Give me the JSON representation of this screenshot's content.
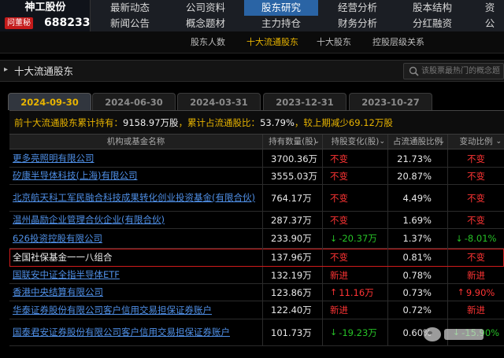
{
  "stock": {
    "name": "神工股份",
    "tag": "问董秘",
    "code": "688233"
  },
  "nav": {
    "row1": [
      "最新动态",
      "公司资料",
      "股东研究",
      "经营分析",
      "股本结构",
      "资"
    ],
    "row2": [
      "新闻公告",
      "概念题材",
      "主力持仓",
      "财务分析",
      "分红融资",
      "公"
    ],
    "active": "股东研究"
  },
  "subnav": [
    "股东人数",
    "十大流通股东",
    "十大股东",
    "控股层级关系"
  ],
  "subnav_active": "十大流通股东",
  "section": {
    "title": "十大流通股东",
    "search_placeholder": "该股票最热门的概念题"
  },
  "tabs": [
    "2024-09-30",
    "2024-06-30",
    "2024-03-31",
    "2023-12-31",
    "2023-10-27"
  ],
  "active_tab": "2024-09-30",
  "summary": {
    "label1": "前十大流通股东累计持有：",
    "holding": "9158.97万股",
    "label2": "，累计占流通股比：",
    "ratio": "53.79%",
    "label3": "，较上期减少",
    "change": "69.12万股"
  },
  "table": {
    "headers": [
      "机构或基金名称",
      "持有数量(股)",
      "持股变化(股)",
      "占流通股比例",
      "变动比例"
    ],
    "rows": [
      {
        "name": "更多亮照明有限公司",
        "qty": "3700.36万",
        "chg": "不变",
        "chg_dir": "none",
        "ratio": "21.73%",
        "pct": "不变",
        "pct_dir": "none"
      },
      {
        "name": "矽康半导体科技(上海)有限公司",
        "qty": "3555.03万",
        "chg": "不变",
        "chg_dir": "none",
        "ratio": "20.87%",
        "pct": "不变",
        "pct_dir": "none"
      },
      {
        "name": "北京航天科工军民融合科技成果转化创业投资基金(有限合伙)",
        "qty": "764.17万",
        "chg": "不变",
        "chg_dir": "none",
        "ratio": "4.49%",
        "pct": "不变",
        "pct_dir": "none"
      },
      {
        "name": "温州晶励企业管理合伙企业(有限合伙)",
        "qty": "287.37万",
        "chg": "不变",
        "chg_dir": "none",
        "ratio": "1.69%",
        "pct": "不变",
        "pct_dir": "none"
      },
      {
        "name": "626投资控股有限公司",
        "qty": "233.90万",
        "chg": "-20.37万",
        "chg_dir": "down",
        "ratio": "1.37%",
        "pct": "-8.01%",
        "pct_dir": "down"
      },
      {
        "name": "全国社保基金一一八组合",
        "qty": "137.96万",
        "chg": "不变",
        "chg_dir": "none",
        "ratio": "0.81%",
        "pct": "不变",
        "pct_dir": "none"
      },
      {
        "name": "国联安中证全指半导体ETF",
        "qty": "132.19万",
        "chg": "新进",
        "chg_dir": "new",
        "ratio": "0.78%",
        "pct": "新进",
        "pct_dir": "new"
      },
      {
        "name": "香港中央结算有限公司",
        "qty": "123.86万",
        "chg": "11.16万",
        "chg_dir": "up",
        "ratio": "0.73%",
        "pct": "9.90%",
        "pct_dir": "up"
      },
      {
        "name": "华泰证券股份有限公司客户信用交易担保证券账户",
        "qty": "122.40万",
        "chg": "新进",
        "chg_dir": "new",
        "ratio": "0.72%",
        "pct": "新进",
        "pct_dir": "new"
      },
      {
        "name": "国泰君安证券股份有限公司客户信用交易担保证券账户",
        "qty": "101.73万",
        "chg": "-19.23万",
        "chg_dir": "down",
        "ratio": "0.60%",
        "pct": "-15.90%",
        "pct_dir": "down"
      }
    ]
  },
  "colors": {
    "accent": "#e8b400",
    "link": "#4f8fe6",
    "up": "#ff3434",
    "down": "#27c227",
    "nav_active": "#2a64a5"
  }
}
